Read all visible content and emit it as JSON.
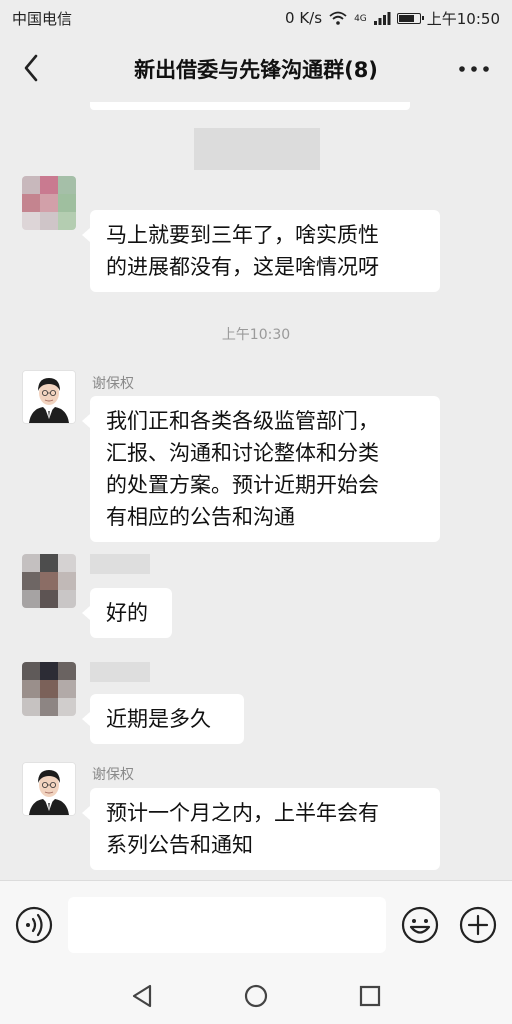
{
  "status_bar": {
    "carrier": "中国电信",
    "net_speed": "0 K/s",
    "net_type": "4G",
    "time": "上午10:50"
  },
  "header": {
    "title": "新出借委与先锋沟通群(8)",
    "icons": {
      "back": "chevron-left-icon",
      "more": "more-dots-icon"
    }
  },
  "messages": [
    {
      "sender": "",
      "avatar": "pixelated-avatar",
      "text": "马上就要到三年了，啥实质性\n的进展都没有，这是啥情况呀"
    },
    {
      "sender": "谢保权",
      "avatar": "person-avatar",
      "text": "我们正和各类各级监管部门，\n汇报、沟通和讨论整体和分类\n的处置方案。预计近期开始会\n有相应的公告和沟通"
    },
    {
      "sender": "",
      "avatar": "pixelated-avatar",
      "text": "好的"
    },
    {
      "sender": "",
      "avatar": "pixelated-avatar",
      "text": "近期是多久"
    },
    {
      "sender": "谢保权",
      "avatar": "person-avatar",
      "text": "预计一个月之内，上半年会有\n系列公告和通知"
    }
  ],
  "time_separator": "上午10:30",
  "input_bar": {
    "placeholder": "",
    "icons": {
      "voice": "voice-icon",
      "emoji": "emoji-icon",
      "plus": "plus-icon"
    }
  },
  "nav_bar": {
    "icons": {
      "back": "triangle-back-icon",
      "home": "circle-home-icon",
      "recent": "square-recent-icon"
    }
  },
  "colors": {
    "chat_background": "#ededed",
    "bubble": "#ffffff",
    "input_bar": "#f7f7f7"
  }
}
